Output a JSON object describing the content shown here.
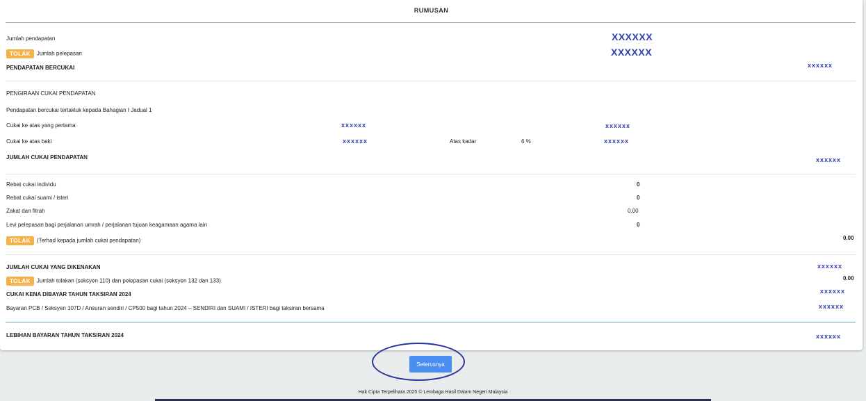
{
  "header": {
    "title": "RUMUSAN"
  },
  "badge_label": "TOLAK",
  "income": {
    "jumlah_pendapatan_label": "Jumlah pendapatan",
    "jumlah_pendapatan_value": "XXXXXX",
    "jumlah_pelepasan_label": "Jumlah pelepasan",
    "jumlah_pelepasan_value": "XXXXXX",
    "pendapatan_bercukai_label": "PENDAPATAN BERCUKAI",
    "pendapatan_bercukai_value": "xxxxxx"
  },
  "tax_calc": {
    "heading": "PENGIRAAN CUKAI PENDAPATAN",
    "subject_label": "Pendapatan bercukai tertakluk kepada Bahagian I Jadual 1",
    "first_label": "Cukai ke atas yang pertama",
    "first_amount": "xxxxxx",
    "first_tax": "xxxxxx",
    "balance_label": "Cukai ke atas baki",
    "balance_amount": "xxxxxx",
    "rate_label": "Atas kadar",
    "rate_value": "6 %",
    "balance_tax": "xxxxxx",
    "total_label": "JUMLAH CUKAI PENDAPATAN",
    "total_value": "xxxxxx"
  },
  "rebates": {
    "individu_label": "Rebat cukai individu",
    "individu_value": "0",
    "suami_isteri_label": "Rebat cukai suami / isteri",
    "suami_isteri_value": "0",
    "zakat_label": "Zakat dan fitrah",
    "zakat_value": "0.00",
    "levi_label": "Levi pelepasan bagi perjalanan umrah / perjalanan tujuan keagamaan agama lain",
    "levi_value": "0",
    "limit_label": "(Terhad kepada jumlah cukai pendapatan)",
    "limit_value": "0.00"
  },
  "summary": {
    "charged_label": "JUMLAH CUKAI YANG DIKENAKAN",
    "charged_value": "xxxxxx",
    "deduct_label": "Jumlah tolakan (seksyen 110) dan pelepasan cukai (seksyen 132 dan 133)",
    "deduct_value": "0.00",
    "payable_label": "CUKAI KENA DIBAYAR TAHUN TAKSIRAN 2024",
    "payable_value": "xxxxxx",
    "pcb_label": "Bayaran PCB / Seksyen 107D / Ansuran sendiri / CP500 bagi tahun 2024 – SENDIRI dan SUAMI / ISTERI bagi taksiran bersama",
    "pcb_value": "xxxxxx",
    "excess_label": "LEBIHAN BAYARAN TAHUN TAKSIRAN 2024",
    "excess_value": "xxxxxx"
  },
  "actions": {
    "next_label": "Seterusnya"
  },
  "footer": {
    "copyright": "Hak Cipta Terpelihara 2025 © Lembaga Hasil Dalam Negeri Malaysia"
  },
  "colors": {
    "accent_blue": "#2f3fb3",
    "badge_orange": "#f6b24a",
    "button_blue": "#4b8ef2",
    "annotation_circle": "#2632a0"
  }
}
